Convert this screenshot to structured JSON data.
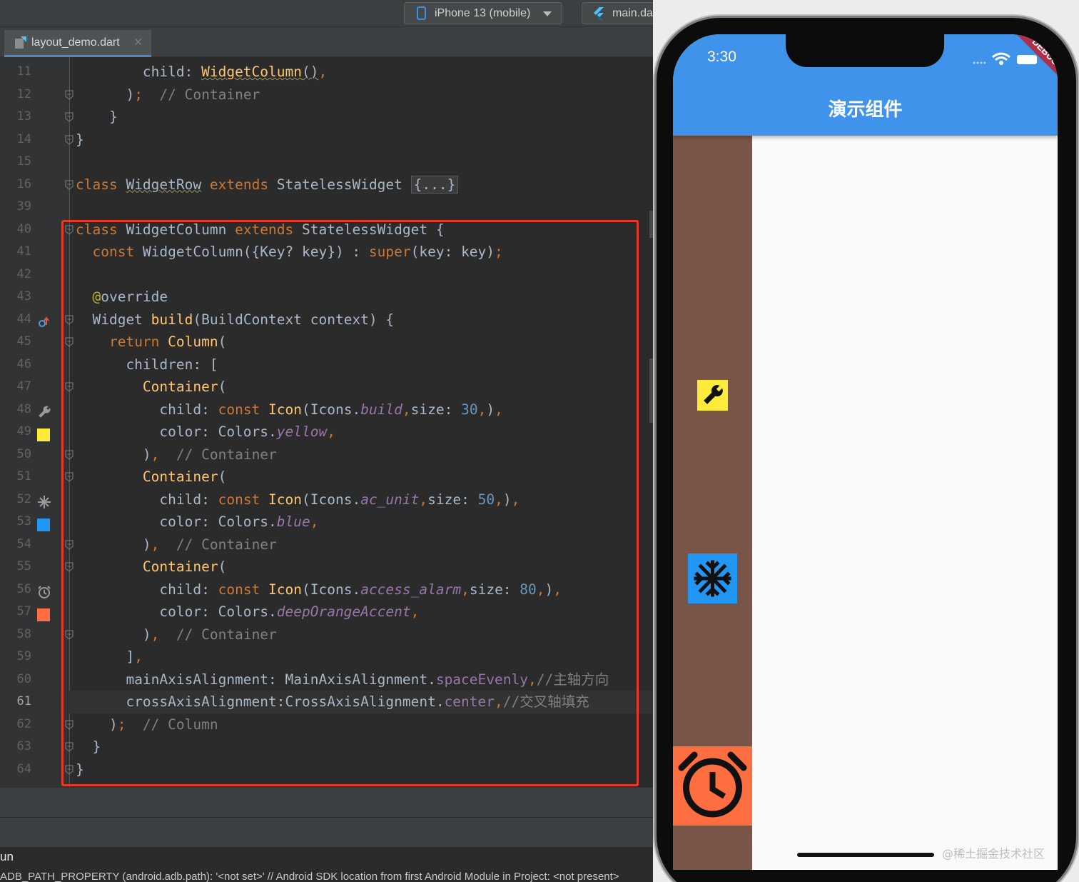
{
  "toolbar": {
    "device": "iPhone 13 (mobile)",
    "run_config": "main.dart"
  },
  "tab": {
    "file_name": "layout_demo.dart",
    "close_glyph": "✕"
  },
  "editor": {
    "lines": [
      {
        "n": "11",
        "html": "        child: <span class=\"fn sq\">WidgetColumn</span><span class=\"sq\">()</span><span class=\"kw\">,</span>"
      },
      {
        "n": "12",
        "html": "      )<span class=\"kw\">;</span>  <span class=\"cmt\">// Container</span>"
      },
      {
        "n": "13",
        "html": "    }"
      },
      {
        "n": "14",
        "html": "}"
      },
      {
        "n": "15",
        "html": ""
      },
      {
        "n": "16",
        "html": "<span class=\"kw\">class</span> <span class=\"sq\">WidgetRow</span> <span class=\"kw\">extends</span> StatelessWidget <span class=\"fold-box\">{...}</span>"
      },
      {
        "n": "39",
        "html": ""
      },
      {
        "n": "40",
        "html": "<span class=\"kw\">class</span> WidgetColumn <span class=\"kw\">extends</span> StatelessWidget {"
      },
      {
        "n": "41",
        "html": "  <span class=\"kw\">const</span> WidgetColumn({Key? key}) : <span class=\"kw\">super</span>(key: key)<span class=\"kw\">;</span>"
      },
      {
        "n": "42",
        "html": ""
      },
      {
        "n": "43",
        "html": "  <span class=\"ann\">@</span>override"
      },
      {
        "n": "44",
        "html": "  Widget <span class=\"fn\">build</span>(BuildContext context) {"
      },
      {
        "n": "45",
        "html": "    <span class=\"kw\">return</span> <span class=\"fn\">Column</span>("
      },
      {
        "n": "46",
        "html": "      children: ["
      },
      {
        "n": "47",
        "html": "        <span class=\"fn\">Container</span>("
      },
      {
        "n": "48",
        "html": "          child: <span class=\"kw\">const</span> <span class=\"fn\">Icon</span>(Icons.<span class=\"ital\">build</span><span class=\"kw\">,</span>size: <span class=\"num\">30</span><span class=\"kw\">,</span>)<span class=\"kw\">,</span>"
      },
      {
        "n": "49",
        "html": "          color: Colors.<span class=\"ital\">yellow</span><span class=\"kw\">,</span>"
      },
      {
        "n": "50",
        "html": "        )<span class=\"kw\">,</span>  <span class=\"cmt\">// Container</span>"
      },
      {
        "n": "51",
        "html": "        <span class=\"fn\">Container</span>("
      },
      {
        "n": "52",
        "html": "          child: <span class=\"kw\">const</span> <span class=\"fn\">Icon</span>(Icons.<span class=\"ital\">ac_unit</span><span class=\"kw\">,</span>size: <span class=\"num\">50</span><span class=\"kw\">,</span>)<span class=\"kw\">,</span>"
      },
      {
        "n": "53",
        "html": "          color: Colors.<span class=\"ital\">blue</span><span class=\"kw\">,</span>"
      },
      {
        "n": "54",
        "html": "        )<span class=\"kw\">,</span>  <span class=\"cmt\">// Container</span>"
      },
      {
        "n": "55",
        "html": "        <span class=\"fn\">Container</span>("
      },
      {
        "n": "56",
        "html": "          child: <span class=\"kw\">const</span> <span class=\"fn\">Icon</span>(Icons.<span class=\"ital\">access_alarm</span><span class=\"kw\">,</span>size: <span class=\"num\">80</span><span class=\"kw\">,</span>)<span class=\"kw\">,</span>"
      },
      {
        "n": "57",
        "html": "          color: Colors.<span class=\"ital\">deepOrangeAccent</span><span class=\"kw\">,</span>"
      },
      {
        "n": "58",
        "html": "        )<span class=\"kw\">,</span>  <span class=\"cmt\">// Container</span>"
      },
      {
        "n": "59",
        "html": "      ]<span class=\"kw\">,</span>"
      },
      {
        "n": "60",
        "html": "      mainAxisAlignment: MainAxisAlignment.<span class=\"ital\" style=\"font-style:normal\">spaceEvenly</span><span class=\"kw\">,</span><span class=\"cmt\">//主轴方向</span>"
      },
      {
        "n": "61",
        "html": "      crossAxisAlignment:CrossAxisAlignment.<span class=\"ital\" style=\"font-style:normal\">center</span><span class=\"kw\">,</span><span class=\"cmt\">//交叉轴填充</span>"
      },
      {
        "n": "62",
        "html": "    )<span class=\"kw\">;</span>  <span class=\"cmt\">// Column</span>"
      },
      {
        "n": "63",
        "html": "  }"
      },
      {
        "n": "64",
        "html": "}"
      }
    ]
  },
  "gutter_icons": {
    "44": "override-icon",
    "48": "wrench-icon",
    "49": "yellow-swatch-icon",
    "52": "snowflake-icon",
    "53": "blue-swatch-icon",
    "56": "alarm-icon",
    "57": "orange-swatch-icon"
  },
  "colors": {
    "yellow": "#ffeb3b",
    "blue": "#2196f3",
    "deep_orange_accent": "#ff6e40",
    "brown": "#795548",
    "appbar": "#3f93eb",
    "highlight": "#e53a2a"
  },
  "bottom": {
    "run_label": "un",
    "log": "ADB_PATH_PROPERTY (android.adb.path): '<not set>' // Android SDK location from first Android Module in Project: <not present>"
  },
  "simulator": {
    "time": "3:30",
    "app_title": "演示组件",
    "debug_label": "DEBUG",
    "watermark": "@稀土掘金技术社区"
  }
}
